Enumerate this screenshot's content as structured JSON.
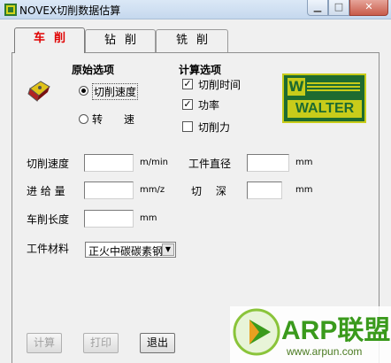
{
  "window": {
    "title": "NOVEX切削数据估算"
  },
  "tabs": [
    {
      "label": "车削",
      "active": true
    },
    {
      "label": "钻削",
      "active": false
    },
    {
      "label": "铣削",
      "active": false
    }
  ],
  "original_options": {
    "title": "原始选项",
    "cutting_speed": {
      "label": "切削速度",
      "selected": true
    },
    "rotation_speed": {
      "label": "转　　速",
      "selected": false
    }
  },
  "calc_options": {
    "title": "计算选项",
    "cutting_time": {
      "label": "切削时间",
      "checked": true
    },
    "power": {
      "label": "功率",
      "checked": true
    },
    "cutting_force": {
      "label": "切削力",
      "checked": false
    }
  },
  "fields": {
    "cutting_speed": {
      "label": "切削速度",
      "unit": "m/min",
      "value": ""
    },
    "workpiece_diameter": {
      "label": "工件直径",
      "unit": "mm",
      "value": ""
    },
    "feed": {
      "label": "进 给 量",
      "unit": "mm/z",
      "value": ""
    },
    "cut_depth": {
      "label": "切　 深",
      "unit": "mm",
      "value": ""
    },
    "cut_length": {
      "label": "车削长度",
      "unit": "mm",
      "value": ""
    }
  },
  "material": {
    "label": "工件材料",
    "selected": "正火中碳碳素钢"
  },
  "buttons": {
    "calculate": "计算",
    "print": "打印",
    "exit": "退出"
  },
  "logo": {
    "brand": "WALTER",
    "mark": "W"
  },
  "watermark": {
    "name": "ARP联盟",
    "url": "www.arpun.com"
  },
  "colors": {
    "active_tab": "#e00000",
    "logo_green": "#1e6b30",
    "logo_yellow": "#c8cc1a",
    "watermark_green": "#3a9a1c"
  },
  "icons": {
    "app": "app-icon",
    "tool": "turning-insert-icon"
  }
}
